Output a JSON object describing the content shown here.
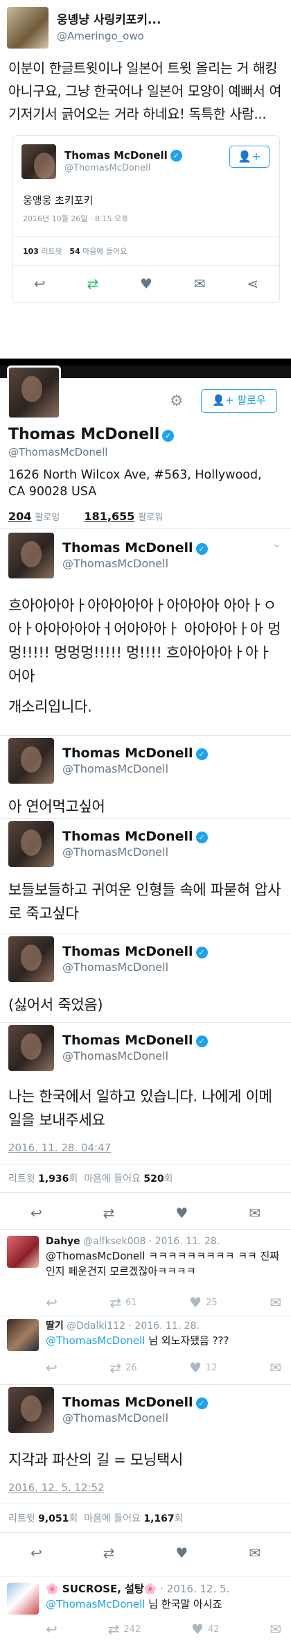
{
  "top": {
    "user_name": "웅녱냥 사링키포키...",
    "user_handle": "@Ameringo_owo",
    "body": "이분이 한글트윗이나 일본어 트윗 올리는 거 해킹 아니구요, 그냥 한국어나 일본어 모양이 예뻐서 여기저기서 긁어오는 거라 하네요! 독특한 사람...",
    "quote": {
      "name": "Thomas McDonell",
      "handle": "@ThomasMcDonell",
      "text": "웅앵웅 초키포키",
      "date": "2016년 10월 26일 · 8:15 오후",
      "retweets": "103",
      "retweets_label": "리트윗",
      "likes": "54",
      "likes_label": "마음에 들어요"
    }
  },
  "profile": {
    "follow_label": "팔로우",
    "name": "Thomas McDonell",
    "handle": "@ThomasMcDonell",
    "address": "1626 North Wilcox Ave, #563, Hollywood, CA 90028 USA",
    "following": "204",
    "following_label": "팔로잉",
    "followers": "181,655",
    "followers_label": "팔로워"
  },
  "author": {
    "name": "Thomas McDonell",
    "handle": "@ThomasMcDonell"
  },
  "tweets": {
    "t1": "흐아아아아ㅏ아아아아아ㅏ아아아아 아아ㅏㅇ아ㅏ아아아아아ㅓ어아아아ㅏ 아아아아ㅏ아 멍멍!!!!! 멍멍멍!!!!! 멍!!!! 흐아아아아ㅏ아ㅏ어아",
    "t1b": "개소리입니다.",
    "t2": "아 연어먹고싶어",
    "t3": "보들보들하고 귀여운 인형들 속에 파묻혀 압사로 죽고싶다",
    "t4": "(싫어서 죽었음)",
    "t5": "나는 한국에서 일하고 있습니다. 나에게 이메일을 보내주세요",
    "t5_date": "2016. 11. 28. 04:47",
    "t5_stats": {
      "retweet_label": "리트윗",
      "retweets": "1,936",
      "retweets_suffix": "회",
      "likes_label": "마음에 들어요",
      "likes": "520",
      "likes_suffix": "회"
    },
    "t6": "지각과 파산의 길 = 모닝택시",
    "t6_date": "2016. 12. 5. 12:52",
    "t6_stats": {
      "retweet_label": "리트윗",
      "retweets": "9,051",
      "retweets_suffix": "회",
      "likes_label": "마음에 들어요",
      "likes": "1,167",
      "likes_suffix": "회"
    }
  },
  "replies": {
    "r1": {
      "name": "Dahye",
      "handle": "@alfksek008",
      "date": "· 2016. 11. 28.",
      "text": "@ThomasMcDonell ㅋㅋㅋㅋㅋㅋㅋㅋㅋ ㅋㅋ 진짜인지 페운건지 모르겠잖아ㅋㅋㅋㅋ",
      "rt": "61",
      "like": "25"
    },
    "r2": {
      "name": "딸기",
      "handle": "@Ddalki112",
      "date": "· 2016. 11. 28.",
      "mention": "@ThomasMcDonell",
      "text": "님 외노자됐음 ???",
      "rt": "26",
      "like": "12"
    },
    "r3": {
      "name": "🌸 SUCROSE, 설탕🌸",
      "date": "· 2016. 12. 5.",
      "mention": "@ThomasMcDonell",
      "text": "님 한국말 아시죠",
      "rt": "242",
      "like": "42"
    }
  }
}
